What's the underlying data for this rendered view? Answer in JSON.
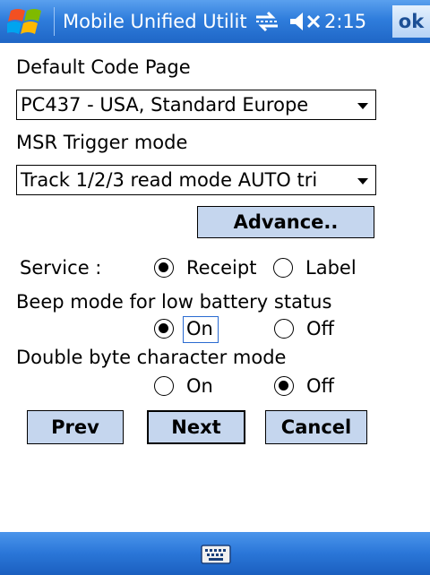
{
  "titlebar": {
    "title": "Mobile Unified Utilit",
    "clock": "2:15",
    "ok_label": "ok",
    "icons": [
      "windows-logo",
      "connectivity-icon",
      "volume-muted-icon"
    ],
    "color": "#2f7ddc"
  },
  "form": {
    "code_page_label": "Default Code Page",
    "code_page_value": "PC437 - USA, Standard Europe",
    "msr_label": "MSR Trigger mode",
    "msr_value": "Track 1/2/3 read mode AUTO tri",
    "advance_label": "Advance..",
    "service": {
      "label": "Service :",
      "options": [
        "Receipt",
        "Label"
      ],
      "selected": "Receipt"
    },
    "beep": {
      "label": "Beep mode for low battery status",
      "on_label": "On",
      "off_label": "Off",
      "selected": "On"
    },
    "double_byte": {
      "label": "Double byte character mode",
      "on_label": "On",
      "off_label": "Off",
      "selected": "Off"
    },
    "buttons": {
      "prev": "Prev",
      "next": "Next",
      "cancel": "Cancel"
    }
  },
  "bottombar": {
    "icon": "keyboard-icon",
    "color": "#2a76d8"
  }
}
